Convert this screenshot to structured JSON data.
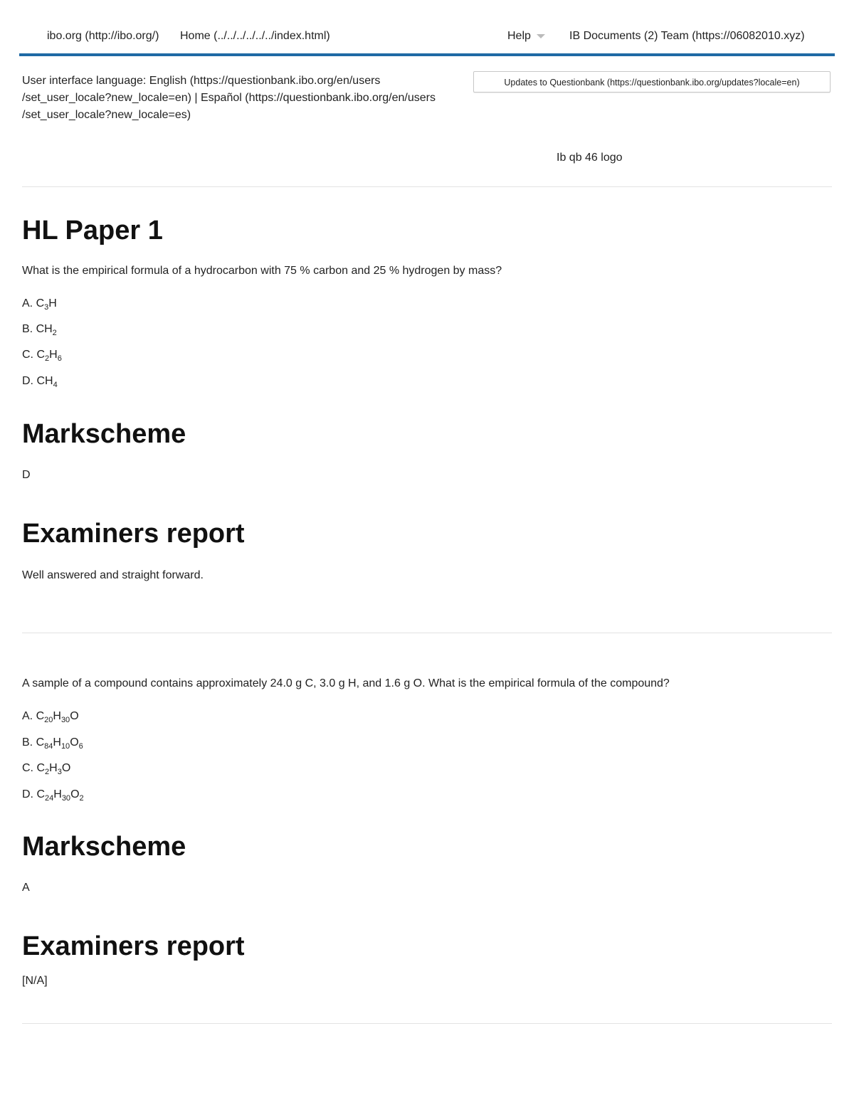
{
  "nav": {
    "ibo": "ibo.org (http://ibo.org/)",
    "home": "Home (../../../../../../index.html)",
    "help": "Help",
    "team": "IB Documents (2) Team (https://06082010.xyz)"
  },
  "locale": {
    "line1": "User interface language: English (https://questionbank.ibo.org/en/users",
    "line2": "/set_user_locale?new_locale=en) | Español (https://questionbank.ibo.org/en/users",
    "line3": "/set_user_locale?new_locale=es)"
  },
  "updates_button": "Updates to Questionbank (https://questionbank.ibo.org/updates?locale=en)",
  "logo_alt": "Ib qb 46 logo",
  "page_title": "HL Paper 1",
  "q1": {
    "question": "What is the empirical formula of a hydrocarbon with 75 % carbon and 25 % hydrogen by mass?",
    "options": [
      [
        "A. C",
        "3",
        "H"
      ],
      [
        "B. CH",
        "2",
        ""
      ],
      [
        "C. C",
        "2",
        "H",
        "6",
        ""
      ],
      [
        "D. CH",
        "4",
        ""
      ]
    ],
    "markscheme_heading": "Markscheme",
    "markscheme": "D",
    "report_heading": "Examiners report",
    "report": "Well answered and straight forward."
  },
  "q2": {
    "question": "A sample of a compound contains approximately 24.0 g C, 3.0 g H, and 1.6 g O. What is the empirical formula of the compound?",
    "options": [
      [
        "A.  C",
        "20",
        "H",
        "30",
        "O"
      ],
      [
        "B.  C",
        "84",
        "H",
        "10",
        "O",
        "6",
        ""
      ],
      [
        "C.  C",
        "2",
        "H",
        "3",
        "O"
      ],
      [
        "D.  C",
        "24",
        "H",
        "30",
        "O",
        "2",
        ""
      ]
    ],
    "markscheme_heading": "Markscheme",
    "markscheme": "A",
    "report_heading": "Examiners report",
    "report": "[N/A]"
  }
}
